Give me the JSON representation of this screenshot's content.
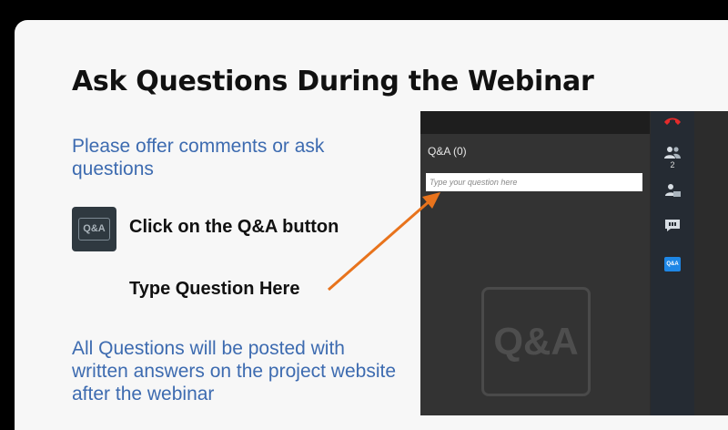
{
  "slide": {
    "title": "Ask Questions During the Webinar",
    "intro_text": "Please offer comments or ask questions",
    "qa_badge_label": "Q&A",
    "click_instruction": "Click on the Q&A button",
    "type_instruction": "Type Question Here",
    "outro_text": "All Questions will be posted with written answers on the project website after the webinar"
  },
  "webinar_panel": {
    "qa_header": "Q&A (0)",
    "question_input_placeholder": "Type your question here",
    "qa_watermark": "Q&A",
    "sidebar": {
      "hangup_icon": "phone-hangup-icon",
      "attendees_icon": "attendees-icon",
      "attendee_count": "2",
      "presenter_icon": "presenter-icon",
      "chat_icon": "chat-icon",
      "qa_button_label": "Q&A"
    }
  },
  "colors": {
    "accent_blue": "#3d6bb0",
    "arrow_orange": "#e8731c",
    "hangup_red": "#e52b2b",
    "qa_button_blue": "#1e87e6"
  }
}
